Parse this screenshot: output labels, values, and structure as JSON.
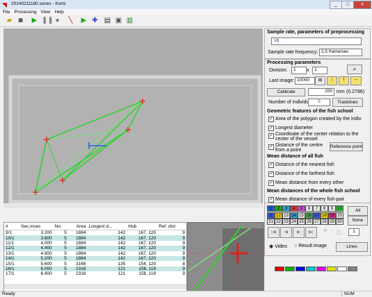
{
  "window": {
    "title": "20140211180.sxnes - Komi",
    "minimize": "_",
    "maximize": "□",
    "close": "x"
  },
  "menu": [
    "File",
    "Processing",
    "View",
    "Help"
  ],
  "table": {
    "columns": [
      "#",
      "Sec.msec",
      "No.",
      "Area",
      "Longest d...",
      "Hub",
      "Ref. dist"
    ],
    "rows": [
      [
        "9/1",
        "3.200",
        "5",
        "1884",
        "142",
        "167, 120",
        "9"
      ],
      [
        "10/1",
        "3.600",
        "5",
        "1884",
        "142",
        "167, 120",
        "9"
      ],
      [
        "11/1",
        "4.000",
        "5",
        "1884",
        "142",
        "167, 120",
        "9"
      ],
      [
        "12/1",
        "4.400",
        "5",
        "1884",
        "142",
        "167, 120",
        "9"
      ],
      [
        "13/1",
        "4.800",
        "5",
        "1884",
        "142",
        "167, 120",
        "9"
      ],
      [
        "14/1",
        "5.200",
        "5",
        "1884",
        "142",
        "167, 120",
        "9"
      ],
      [
        "15/1",
        "5.600",
        "5",
        "3168",
        "135",
        "154, 120",
        "8"
      ],
      [
        "16/1",
        "6.000",
        "5",
        "2316",
        "121",
        "158, 119",
        "9"
      ],
      [
        "17/1",
        "6.400",
        "5",
        "2316",
        "121",
        "158, 119",
        "9"
      ]
    ]
  },
  "sample_rate": {
    "header": "Sample rate, parameters of preprocessing",
    "value": "16",
    "freq_label": "Sample rate frequency:",
    "freq_value": "2,5 frame/sec"
  },
  "processing": {
    "header": "Processing parameters",
    "division_label": "Division:",
    "division_a": "1",
    "x_label": "x",
    "division_b": "1",
    "last_image_label": "Last image:",
    "last_image_value": "10000",
    "calibrate_label": "Calibrate",
    "calib_value": "200",
    "calib_unit": "mm",
    "calib_ratio": "(0.2786)",
    "individuals_label": "Number of individual",
    "individuals_value": "5",
    "tracklines_label": "Tracklines"
  },
  "geometric": {
    "header": "Geometric features of the fish school",
    "items": [
      "Area of the polygon created by the indiv",
      "Longest diameter",
      "Coordinate of the center relation to the center of the vessel",
      "Distance of the centre from a point"
    ],
    "reference_point": "Reference point"
  },
  "mean_all": {
    "header": "Mean distance of all fish",
    "items": [
      "Distance of the nearest fish",
      "Distance of the farthest fish",
      "Mean distance from every other"
    ]
  },
  "mean_whole": {
    "header": "Mean distances of the whole fish school",
    "items": [
      "Mean distance of every fish-pair"
    ]
  },
  "number_grid": {
    "numbers": [
      "1",
      "2",
      "3",
      "4",
      "5",
      "6",
      "7",
      "8",
      "9",
      "10",
      "11",
      "12",
      "13",
      "14",
      "15",
      "16",
      "17",
      "18",
      "19",
      "20",
      "21",
      "22",
      "23",
      "24",
      "25",
      "26",
      "27",
      "28",
      "29",
      "30"
    ],
    "colors": [
      "#1a5cd6",
      "#1fa81f",
      "#2aa6d6",
      "#d63a3a",
      "#c24bd0",
      "#e8e8e8",
      "#e8e8e8",
      "#e8e8e8",
      "#e8e8e8",
      "#33c233",
      "#3a5bdc",
      "#f0d000",
      "#e8e8e8",
      "#2f9fd0",
      "#e8e8e8",
      "#4aa84a",
      "#3a5bdc",
      "#f0d000",
      "#d6307a",
      "#e8e8e8",
      "#e8e8e8",
      "#e8e8e8",
      "#e8e8e8",
      "#e8e8e8",
      "#e8e8e8",
      "#e8e8e8",
      "#e8e8e8",
      "#e8e8e8",
      "#e8e8e8",
      "#e8e8e8"
    ],
    "all_label": "All",
    "none_label": "None",
    "stepper_value": "1"
  },
  "view": {
    "video_label": "Video",
    "result_label": "Result image",
    "lines_label": "Lines"
  },
  "palette": [
    "#e00000",
    "#00b000",
    "#0000e0",
    "#00c0c0",
    "#e000e0",
    "#e0e000",
    "#ffffff",
    "#808080"
  ],
  "status": {
    "left": "Ready",
    "num": "NUM"
  }
}
